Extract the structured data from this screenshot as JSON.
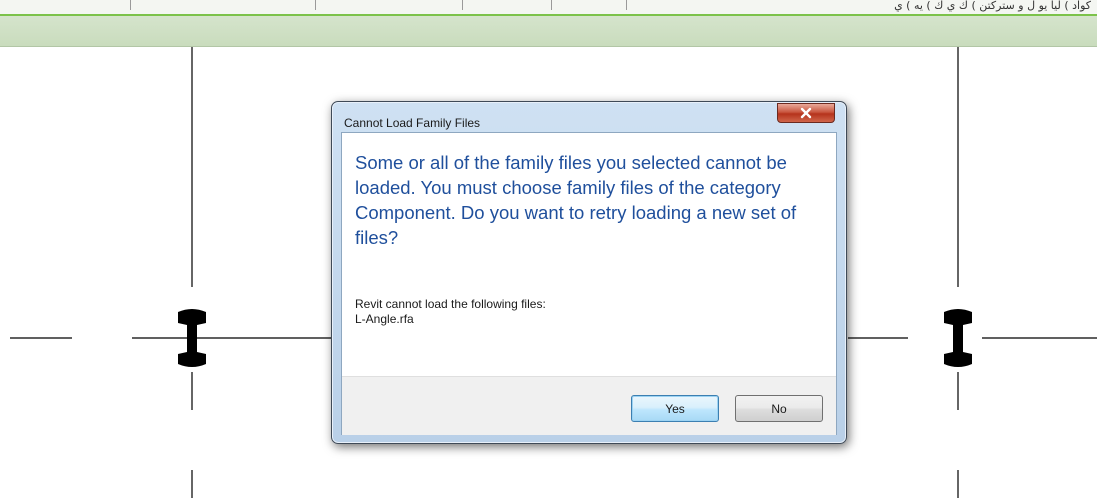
{
  "top_strip": {
    "truncated_text": "كواد ) ليا يو ل و ستركتن ) ك ي ك ) يه ) ي"
  },
  "dialog": {
    "title": "Cannot Load Family Files",
    "close_glyph": "X",
    "main_instruction": "Some or all of the family files you selected cannot be loaded. You must choose family files of the category Component. Do you want to retry loading a new set of files?",
    "content_heading": "Revit cannot load the following files:",
    "file_name": "L-Angle.rfa",
    "buttons": {
      "yes": "Yes",
      "no": "No"
    }
  },
  "colors": {
    "ribbon_band": "#c9dcbd",
    "accent_line": "#7cc24a",
    "instruction_text": "#1f4f9c",
    "dialog_frame": "#b9d0e8",
    "close_button": "#c95740"
  }
}
